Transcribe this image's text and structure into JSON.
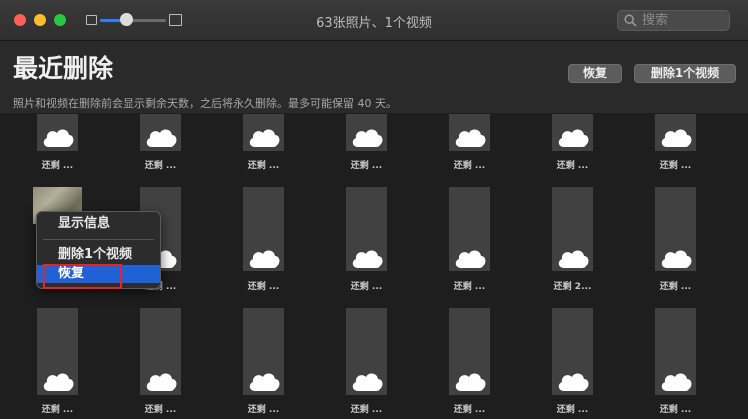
{
  "window": {
    "title": "63张照片、1个视频",
    "search_placeholder": "搜索",
    "zoom_level": 0.4
  },
  "header": {
    "title": "最近删除",
    "subtitle": "照片和视频在删除前会显示剩余天数，之后将永久删除。最多可能保留 40 天。",
    "recover_button": "恢复",
    "delete_button": "删除1个视频"
  },
  "context_menu": {
    "items": [
      "显示信息",
      "删除1个视频",
      "恢复"
    ],
    "selected": "恢复"
  },
  "grid": {
    "rows": [
      [
        "还剩 ...",
        "还剩 ...",
        "还剩 ...",
        "还剩 ...",
        "还剩 ...",
        "还剩 ...",
        "还剩 ..."
      ],
      [
        "",
        "还剩 ...",
        "还剩 ...",
        "还剩 ...",
        "还剩 ...",
        "还剩 2...",
        "还剩 ..."
      ],
      [
        "还剩 ...",
        "还剩 ...",
        "还剩 ...",
        "还剩 ...",
        "还剩 ...",
        "还剩 ...",
        "还剩 ..."
      ]
    ]
  },
  "colors": {
    "accent": "#1f62d6",
    "highlight": "#e0262a"
  }
}
